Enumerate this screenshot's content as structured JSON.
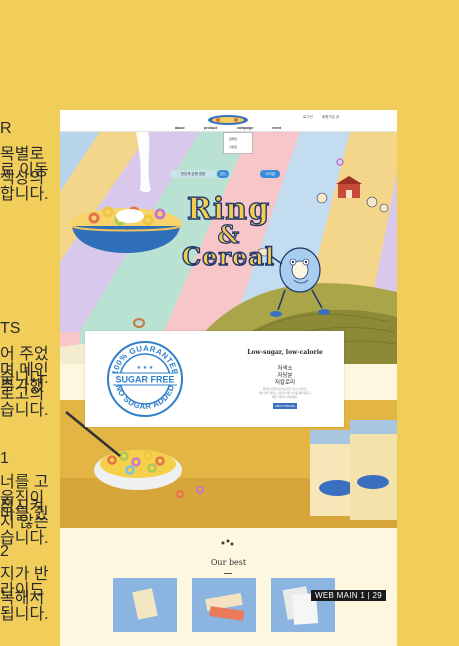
{
  "annotations": [
    {
      "heading": "R",
      "lines": [
        "목별로 색상의",
        "로 이동합니다."
      ]
    },
    {
      "heading": "",
      "lines": []
    },
    {
      "heading": "TS",
      "lines": [
        "어 주었습니다.",
        "며 메인 로고의",
        "추가했습니다."
      ]
    },
    {
      "heading": "1",
      "lines": [
        "너를 고정시켜",
        "움직이지 않는",
        "마를 줬습니다."
      ]
    },
    {
      "heading": "2",
      "lines": [
        "지가 반복해서",
        "라이드 됩니다."
      ]
    }
  ],
  "nav": {
    "util_links": [
      "로그인",
      "회원가입",
      "장"
    ],
    "menu": [
      "about",
      "product",
      "campaign",
      "event"
    ],
    "dropdown_items": [
      "캠페인",
      "이벤트"
    ]
  },
  "hero": {
    "pills": [
      "맛있게 균형 영양",
      "있는",
      "시리얼"
    ],
    "title_line1": "Ring",
    "title_line2": "&",
    "title_line3": "Cereal"
  },
  "sugar_free": {
    "seal_top": "100% GUARANTEE",
    "seal_center": "SUGAR FREE",
    "seal_bottom": "NO SUGAR ADDED",
    "headline": "Low-sugar, low-calorie",
    "korean_lines": [
      "저색소",
      "저당분",
      "저칼로리"
    ],
    "body": [
      "원재료 본연의 풍미를 살린 저당 시리얼로",
      "부담 없이 즐기는 건강한 아침 식사를 제안합니다.",
      "매일 가볍게 시작하세요."
    ],
    "button": "ABOUT BRAND"
  },
  "best": {
    "title": "Our best"
  },
  "caption": {
    "text": "WEB MAIN 1  |  29"
  },
  "colors": {
    "background": "#f1cd5a",
    "mock_bg": "#fdf7df",
    "seal_blue": "#2f7fc9",
    "title_fill": "#f4cf4f",
    "title_stroke": "#21356f"
  }
}
